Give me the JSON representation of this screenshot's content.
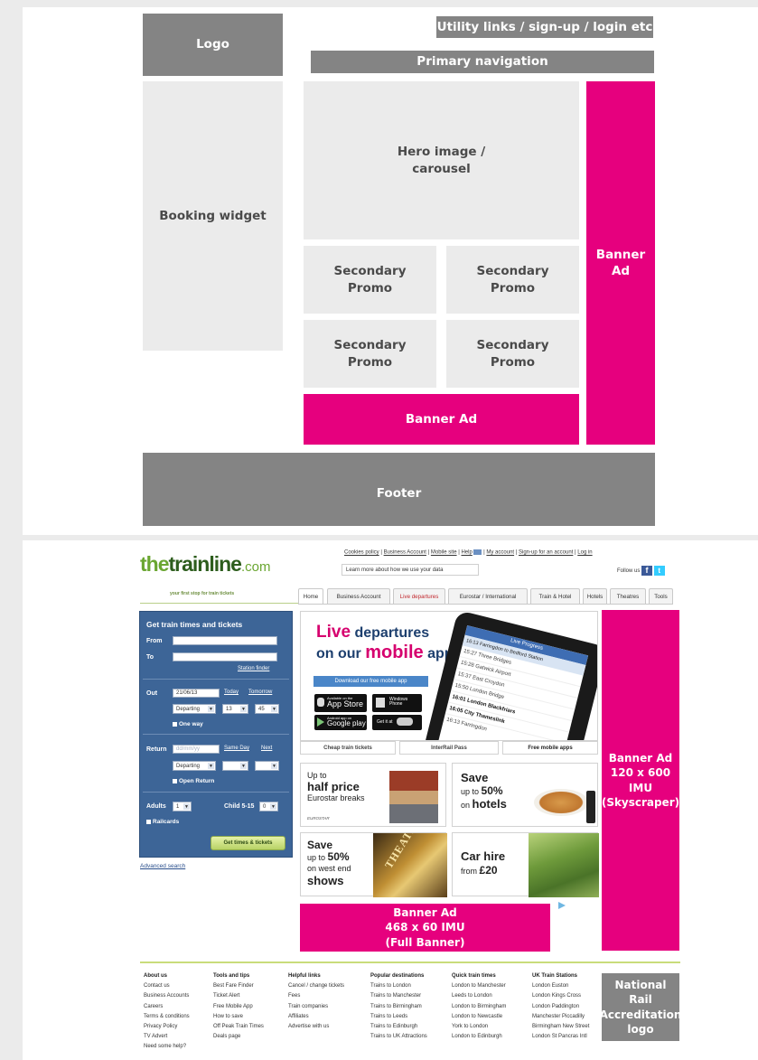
{
  "wireframe": {
    "logo": "Logo",
    "utility": "Utility links / sign-up / login etc",
    "primary_nav": "Primary navigation",
    "booking": "Booking widget",
    "hero": [
      "Hero image /",
      "carousel"
    ],
    "secondary": [
      "Secondary",
      "Promo"
    ],
    "banner_side": [
      "Banner",
      "Ad"
    ],
    "banner_bottom": "Banner Ad",
    "footer": "Footer"
  },
  "mockup": {
    "logo": {
      "prefix": "the",
      "name": "trainline",
      "suffix": ".com",
      "tagline": "your first stop for train tickets"
    },
    "utility_links": [
      "Cookies policy",
      "Business Account",
      "Mobile site",
      "Help",
      "My account",
      "Sign-up for an account",
      "Log in"
    ],
    "cookie_msg": "Learn more about how we use your data",
    "follow": "Follow us",
    "tabs": [
      "Home",
      "Business Account",
      "Live departures",
      "Eurostar / International",
      "Train & Hotel",
      "Hotels",
      "Theatres",
      "Tools"
    ],
    "booking": {
      "title": "Get train times and tickets",
      "from": "From",
      "to": "To",
      "station_finder": "Station finder",
      "out": "Out",
      "out_date": "21/06/13",
      "today": "Today",
      "tomorrow": "Tomorrow",
      "departing": "Departing",
      "hour": "13",
      "minute": "45",
      "one_way": "One way",
      "return": "Return",
      "return_placeholder": "dd/mm/yy",
      "same_day": "Same Day",
      "next": "Next",
      "open_return": "Open Return",
      "adults": "Adults",
      "adults_val": "1",
      "child": "Child 5-15",
      "child_val": "0",
      "railcards": "Railcards",
      "submit": "Get times & tickets",
      "advanced": "Advanced search"
    },
    "hero": {
      "live": "Live",
      "departures": " departures",
      "on_our": "on our ",
      "mobile": "mobile",
      "app": " app",
      "download": "Download our free mobile app",
      "store1_small": "Available on the",
      "store1": "App Store",
      "store2_small": "Windows",
      "store2": "Phone",
      "store3_small": "Android app on",
      "store3": "Google play",
      "store4": "Get it at",
      "phone_header": "Live Progress",
      "phone_rows": [
        "16:13 Farringdon to Bedford Station",
        "15:27 Three Bridges",
        "15:28 Gatwick Airport",
        "15:37 East Croydon",
        "15:50 London Bridge",
        "16:01 London Blackfriars",
        "16:05 City Thameslink",
        "16:13 Farringdon"
      ]
    },
    "hero_tabs": [
      "Cheap train tickets",
      "InterRail Pass",
      "Free mobile apps"
    ],
    "promos": [
      {
        "l1": "Up to",
        "l2": "half price",
        "l3": "Eurostar breaks",
        "brand": "EUROSTAR"
      },
      {
        "l1": "Save",
        "l2": "up to ",
        "l2b": "50%",
        "l3": "on ",
        "l3b": "hotels"
      },
      {
        "l1": "Save",
        "l2": "up to ",
        "l2b": "50%",
        "l3": "on west end",
        "l4": "shows",
        "sign": "THEATRE"
      },
      {
        "l1": "Car hire",
        "l2": "from ",
        "l2b": "£20"
      }
    ],
    "banner_full": [
      "Banner Ad",
      "468 x 60 IMU",
      "(Full Banner)"
    ],
    "banner_sky": [
      "Banner Ad",
      "120 x 600 IMU",
      "(Skyscraper)"
    ],
    "footer_cols": [
      {
        "title": "About us",
        "items": [
          "Contact us",
          "Business Accounts",
          "Careers",
          "Terms & conditions",
          "Privacy Policy",
          "TV Advert",
          "Need some help?"
        ]
      },
      {
        "title": "Tools and tips",
        "items": [
          "Best Fare Finder",
          "Ticket Alert",
          "Free Mobile App",
          "How to save",
          "Off Peak Train Times",
          "Deals page"
        ]
      },
      {
        "title": "Helpful links",
        "items": [
          "Cancel / change tickets",
          "Fees",
          "Train companies",
          "Affiliates",
          "Advertise with us"
        ]
      },
      {
        "title": "Popular destinations",
        "items": [
          "Trains to London",
          "Trains to Manchester",
          "Trains to Birmingham",
          "Trains to Leeds",
          "Trains to Edinburgh",
          "Trains to UK Attractions"
        ]
      },
      {
        "title": "Quick train times",
        "items": [
          "London to Manchester",
          "Leeds to London",
          "London to Birmingham",
          "London to Newcastle",
          "York to London",
          "London to Edinburgh"
        ]
      },
      {
        "title": "UK Train Stations",
        "items": [
          "London Euston",
          "London Kings Cross",
          "London Paddington",
          "Manchester Piccadilly",
          "Birmingham New Street",
          "London St Pancras Intl"
        ]
      }
    ],
    "national_rail": [
      "National Rail",
      "Accreditation",
      "logo"
    ]
  }
}
